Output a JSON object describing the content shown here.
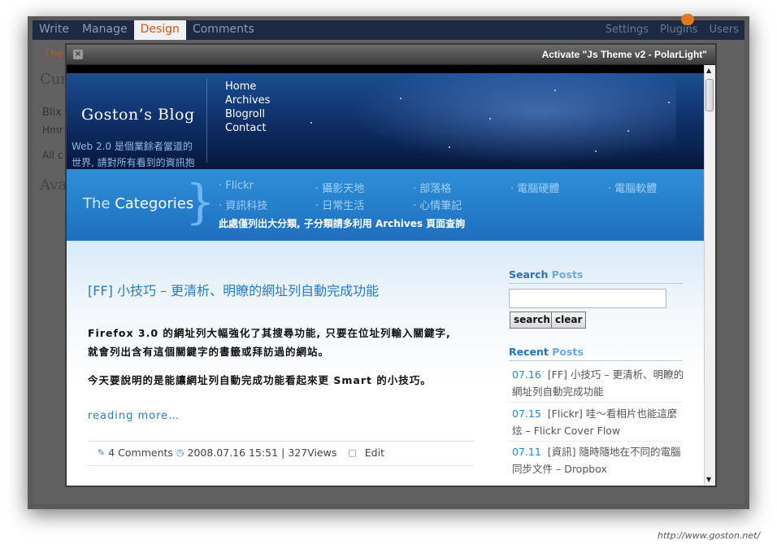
{
  "admin": {
    "nav": [
      "Write",
      "Manage",
      "Design",
      "Comments"
    ],
    "active": "Design",
    "right_nav": [
      "Settings",
      "Plugins",
      "Users"
    ]
  },
  "underlying": {
    "tab": "The",
    "heading_cur": "Cur",
    "blix": "Blix",
    "hmr": "Hmr",
    "all": "All c",
    "heading_ava": "Ava"
  },
  "modal": {
    "close": "×",
    "title": "Activate \"Js Theme v2 - PolarLight\""
  },
  "blog": {
    "title": "Goston’s Blog",
    "description": "Web 2.0 是個業餘者當道的世界, 請對所有看到的資訊抱",
    "nav": [
      "Home",
      "Archives",
      "Blogroll",
      "Contact"
    ]
  },
  "categories": {
    "label_prefix": "The ",
    "label_main": "Categories",
    "items": [
      "Flickr",
      "攝影天地",
      "部落格",
      "電腦硬體",
      "電腦軟體",
      "資訊科技",
      "日常生活",
      "心情筆記"
    ],
    "note": "此處僅列出大分類, 子分類請多利用 Archives 頁面查詢"
  },
  "post": {
    "title": "[FF] 小技巧 – 更清析、明瞭的網址列自動完成功能",
    "p1": "Firefox 3.0 的網址列大幅強化了其搜尋功能, 只要在位址列輸入關鍵字, 就會列出含有這個關鍵字的書籤或拜訪過的網站。",
    "p2": "今天要說明的是能讓網址列自動完成功能看起來更 Smart 的小技巧。",
    "read_more": "reading more…",
    "comments": "4 Comments",
    "date": "2008.07.16 15:51",
    "sep": "|",
    "views": "327Views",
    "edit": "Edit"
  },
  "sidebar": {
    "search_head_a": "Search",
    "search_head_b": "Posts",
    "search_btn": "search",
    "clear_btn": "clear",
    "recent_head_a": "Recent",
    "recent_head_b": "Posts",
    "recent": [
      {
        "date": "07.16",
        "title": "[FF] 小技巧 – 更清析、明瞭的網址列自動完成功能"
      },
      {
        "date": "07.15",
        "title": "[Flickr] 哇～看相片也能這麼炫 – Flickr Cover Flow"
      },
      {
        "date": "07.11",
        "title": "[資訊] 隨時隨地在不同的電腦同步文件 – Dropbox"
      }
    ]
  },
  "watermark": "http://www.goston.net/"
}
